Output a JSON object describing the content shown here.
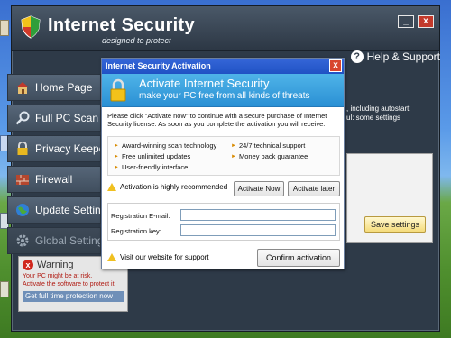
{
  "app": {
    "title": "Internet Security",
    "tagline": "designed to protect",
    "min_label": "_",
    "close_label": "x",
    "help_label": "Help & Support",
    "help_glyph": "?"
  },
  "sidebar": {
    "items": [
      {
        "label": "Home Page",
        "icon": "house-icon"
      },
      {
        "label": "Full PC Scan",
        "icon": "magnifier-icon"
      },
      {
        "label": "Privacy Keeper",
        "icon": "lock-icon"
      },
      {
        "label": "Firewall",
        "icon": "brick-wall-icon"
      },
      {
        "label": "Update Settings",
        "icon": "globe-icon"
      },
      {
        "label": "Global Settings",
        "icon": "gear-icon"
      }
    ]
  },
  "warning": {
    "title": "Warning",
    "glyph": "x",
    "line1": "Your PC might be at risk.",
    "line2": "Activate the software to protect it.",
    "button": "Get full time protection now"
  },
  "right": {
    "info_line1": ", including autostart",
    "info_line2": "ul: some settings",
    "save_label": "Save settings"
  },
  "dialog": {
    "title": "Internet Security Activation",
    "close_glyph": "x",
    "heading": "Activate Internet Security",
    "subheading": "make your PC free from all kinds of threats",
    "intro": "Please click \"Activate now\" to continue with a secure purchase of Internet Security license. As soon as you complete the activation you will receive:",
    "features": [
      "Award-winning scan technology",
      "24/7 technical support",
      "Free unlimited updates",
      "Money back guarantee",
      "User-friendly interface"
    ],
    "recommend": "Activation is highly recommended",
    "activate_now": "Activate Now",
    "activate_later": "Activate later",
    "email_label": "Registration E-mail:",
    "email_value": "",
    "key_label": "Registration key:",
    "key_value": "",
    "visit": "Visit our website for support",
    "confirm": "Confirm activation",
    "bullet": "►"
  },
  "colors": {
    "app_bg": "#2e3a48",
    "dialog_titlebar": "#2052c4",
    "dialog_header": "#2a90d4",
    "warning_red": "#d0261c",
    "save_button": "#f5dc7c"
  }
}
